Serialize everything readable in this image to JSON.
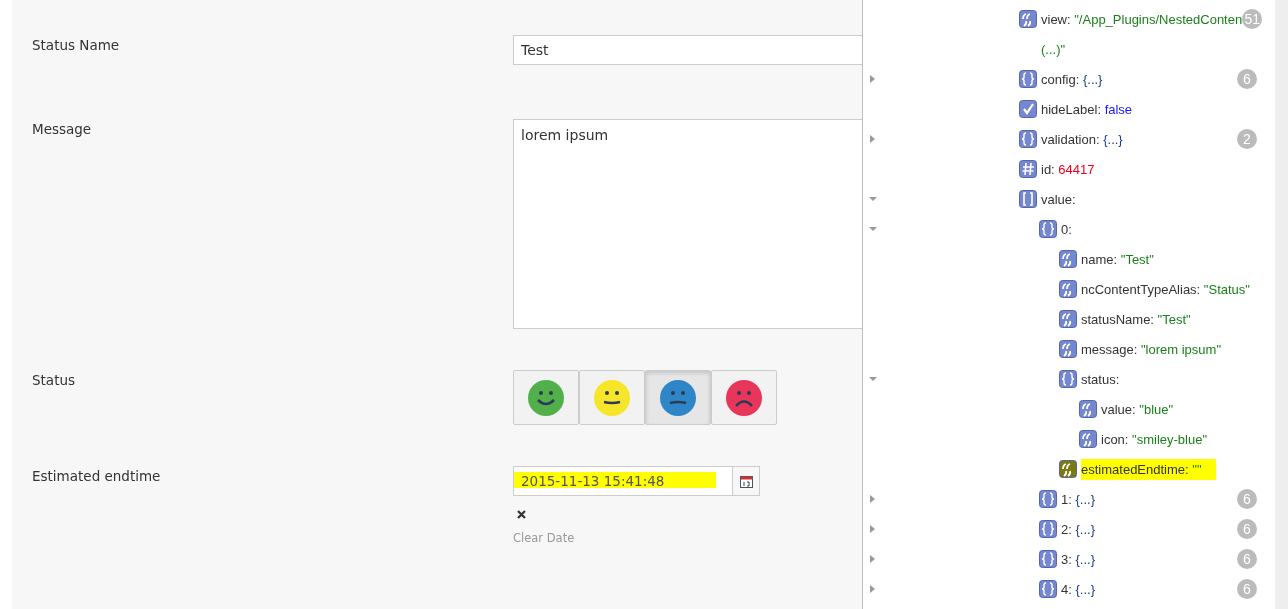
{
  "form": {
    "fields": [
      {
        "kind": "text",
        "label": "Status Name",
        "value": "Test"
      },
      {
        "kind": "textarea",
        "label": "Message",
        "value": "lorem ipsum"
      },
      {
        "kind": "smileys",
        "label": "Status",
        "options": [
          {
            "kind": "happy",
            "color": "#52b04a",
            "selected": false
          },
          {
            "kind": "neutral",
            "color": "#f7e52a",
            "selected": false
          },
          {
            "kind": "unhappy",
            "color": "#2e86c8",
            "selected": true
          },
          {
            "kind": "sad",
            "color": "#e8355a",
            "selected": false
          }
        ]
      },
      {
        "kind": "date",
        "label": "Estimated endtime",
        "value": "2015-11-13 15:41:48",
        "highlighted": true,
        "clear_label": "Clear Date"
      }
    ]
  },
  "inspector": {
    "tree": [
      {
        "kind": "string",
        "key": "view:",
        "value": "\"/App_Plugins/NestedConten",
        "value_continued": "(...)\"",
        "count": "51"
      },
      {
        "kind": "object",
        "key": "config:",
        "value": "{...}",
        "expanded": false,
        "count": "6"
      },
      {
        "kind": "boolean",
        "key": "hideLabel:",
        "value": "false"
      },
      {
        "kind": "object",
        "key": "validation:",
        "value": "{...}",
        "expanded": false,
        "count": "2"
      },
      {
        "kind": "number",
        "key": "id:",
        "value": "64417"
      },
      {
        "kind": "array",
        "key": "value:",
        "expanded": true,
        "children": [
          {
            "kind": "object",
            "key": "0:",
            "expanded": true,
            "children": [
              {
                "kind": "string",
                "key": "name:",
                "value": "\"Test\""
              },
              {
                "kind": "string",
                "key": "ncContentTypeAlias:",
                "value": "\"Status\""
              },
              {
                "kind": "string",
                "key": "statusName:",
                "value": "\"Test\""
              },
              {
                "kind": "string",
                "key": "message:",
                "value": "\"lorem ipsum\""
              },
              {
                "kind": "object",
                "key": "status:",
                "expanded": true,
                "children": [
                  {
                    "kind": "string",
                    "key": "value:",
                    "value": "\"blue\""
                  },
                  {
                    "kind": "string",
                    "key": "icon:",
                    "value": "\"smiley-blue\""
                  }
                ]
              },
              {
                "kind": "string",
                "key": "estimatedEndtime:",
                "value": "\"\"",
                "highlighted": true
              }
            ]
          },
          {
            "kind": "object",
            "key": "1:",
            "value": "{...}",
            "expanded": false,
            "count": "6"
          },
          {
            "kind": "object",
            "key": "2:",
            "value": "{...}",
            "expanded": false,
            "count": "6"
          },
          {
            "kind": "object",
            "key": "3:",
            "value": "{...}",
            "expanded": false,
            "count": "6"
          },
          {
            "kind": "object",
            "key": "4:",
            "value": "{...}",
            "expanded": false,
            "count": "6"
          }
        ]
      }
    ]
  }
}
